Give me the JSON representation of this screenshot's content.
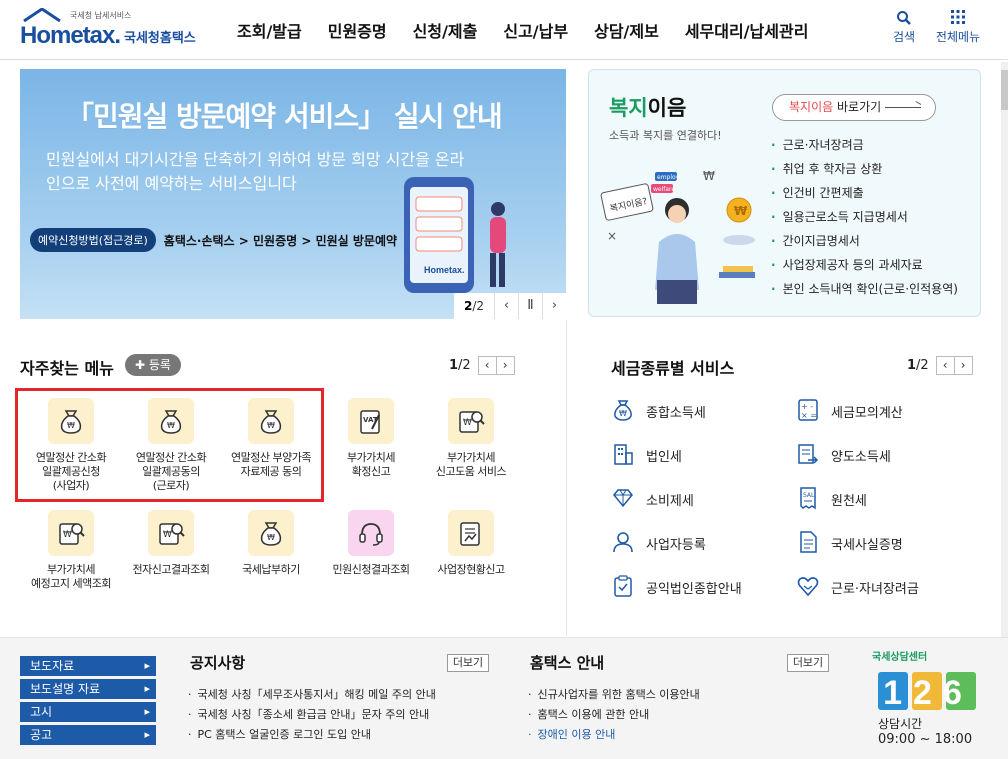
{
  "header": {
    "logo_small": "국세청 납세서비스",
    "logo_brand": "Hometax.",
    "logo_sub": "국세청홈택스",
    "nav": [
      "조회/발급",
      "민원증명",
      "신청/제출",
      "신고/납부",
      "상담/제보",
      "세무대리/납세관리"
    ],
    "search_label": "검색",
    "allmenu_label": "전체메뉴"
  },
  "banner": {
    "title": "「민원실 방문예약 서비스」 실시 안내",
    "desc": "민원실에서 대기시간을 단축하기 위하여 방문 희망 시간을 온라인으로 사전에 예약하는 서비스입니다",
    "route_pill": "예약신청방법(접근경로)",
    "route_path": "홈택스·손택스 > 민원증명 > 민원실 방문예약",
    "page_current": "2",
    "page_total": "/2",
    "illus_label": "Hometax."
  },
  "welfare": {
    "title_green": "복지",
    "title_rest": "이음",
    "subtitle": "소득과 복지를 연결하다!",
    "go_red": "복지이음",
    "go_rest": " 바로가기",
    "items": [
      "근로·자녀장려금",
      "취업 후 학자금 상환",
      "인건비 간편제출",
      "일용근로소득 지급명세서",
      "간이지급명세서",
      "사업장제공자 등의 과세자료",
      "본인 소득내역 확인(근로·인적용역)"
    ],
    "illus_bubble": "복지이음?",
    "illus_tag1": "employ",
    "illus_tag2": "welfare"
  },
  "frequent": {
    "title": "자주찾는 메뉴",
    "register": "✚ 등록",
    "page_current": "1",
    "page_total": "/2",
    "items": [
      {
        "label": "연말정산 간소화\n일괄제공신청\n(사업자)",
        "icon": "money-bag-icon"
      },
      {
        "label": "연말정산 간소화\n일괄제공동의\n(근로자)",
        "icon": "money-bag-icon"
      },
      {
        "label": "연말정산 부양가족\n자료제공 동의",
        "icon": "money-bag-icon"
      },
      {
        "label": "부가가치세\n확정신고",
        "icon": "vat-doc-icon"
      },
      {
        "label": "부가가치세\n신고도움 서비스",
        "icon": "won-search-icon"
      },
      {
        "label": "부가가치세\n예정고지 세액조회",
        "icon": "won-search-icon"
      },
      {
        "label": "전자신고결과조회",
        "icon": "won-search-icon"
      },
      {
        "label": "국세납부하기",
        "icon": "money-bag-icon"
      },
      {
        "label": "민원신청결과조회",
        "icon": "headset-icon"
      },
      {
        "label": "사업장현황신고",
        "icon": "report-doc-icon"
      }
    ]
  },
  "tax_services": {
    "title": "세금종류별 서비스",
    "page_current": "1",
    "page_total": "/2",
    "items": [
      {
        "label": "종합소득세",
        "icon": "money-bag-icon"
      },
      {
        "label": "세금모의계산",
        "icon": "calculator-icon"
      },
      {
        "label": "법인세",
        "icon": "building-icon"
      },
      {
        "label": "양도소득세",
        "icon": "transfer-doc-icon"
      },
      {
        "label": "소비제세",
        "icon": "diamond-icon"
      },
      {
        "label": "원천세",
        "icon": "receipt-icon"
      },
      {
        "label": "사업자등록",
        "icon": "person-icon"
      },
      {
        "label": "국세사실증명",
        "icon": "certificate-icon"
      },
      {
        "label": "공익법인종합안내",
        "icon": "clipboard-icon"
      },
      {
        "label": "근로·자녀장려금",
        "icon": "heart-hands-icon"
      }
    ]
  },
  "footer": {
    "quick_links": [
      "보도자료",
      "보도설명 자료",
      "고시",
      "공고"
    ],
    "notice_title": "공지사항",
    "notice_more": "더보기",
    "notices": [
      "국세청 사칭「세무조사통지서」해킹 메일 주의 안내",
      "국세청 사칭「종소세 환급금 안내」문자 주의 안내",
      "PC 홈택스 얼굴인증 로그인 도입 안내"
    ],
    "guide_title": "홈택스 안내",
    "guide_more": "더보기",
    "guides": [
      "신규사업자를 위한 홈택스 이용안내",
      "홈택스 이용에 관한 안내",
      "장애인 이용 안내"
    ],
    "center_title": "국세상담센터",
    "center_number": "126",
    "hours_label": "상담시간",
    "hours": "09:00 ~ 18:00"
  },
  "colors": {
    "brand": "#1a4fa0",
    "accent_green": "#1a9b62",
    "highlight_red": "#e3262a"
  }
}
